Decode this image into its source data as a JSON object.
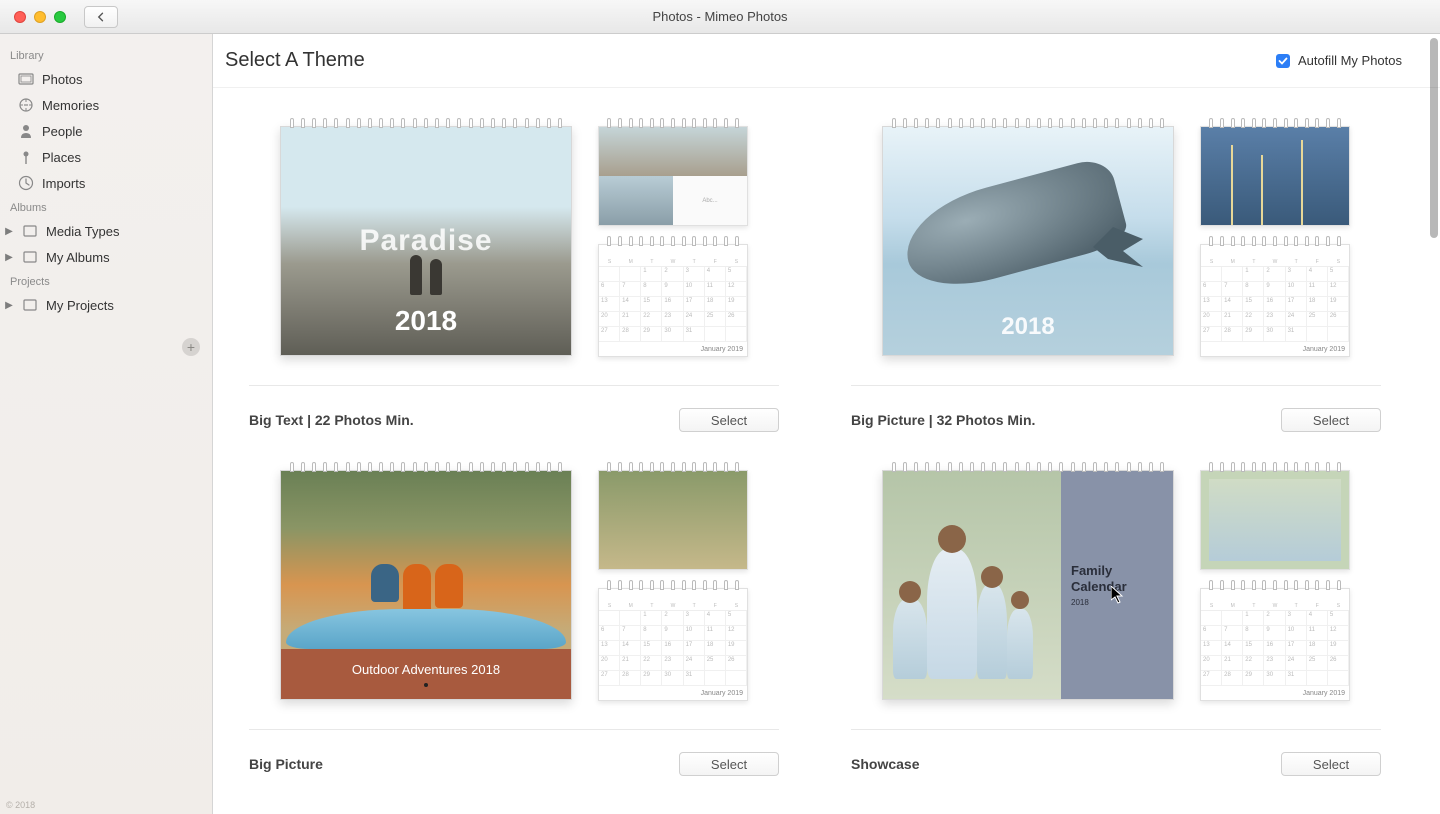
{
  "window": {
    "title": "Photos - Mimeo Photos"
  },
  "sidebar": {
    "sections": {
      "library": {
        "title": "Library",
        "items": [
          "Photos",
          "Memories",
          "People",
          "Places",
          "Imports"
        ]
      },
      "albums": {
        "title": "Albums",
        "items": [
          "Media Types",
          "My Albums"
        ]
      },
      "projects": {
        "title": "Projects",
        "items": [
          "My Projects"
        ]
      }
    },
    "copyright": "© 2018"
  },
  "header": {
    "title": "Select A Theme",
    "autofill_label": "Autofill My Photos",
    "autofill_checked": true
  },
  "themes": [
    {
      "id": "big-text",
      "title": "Big Text | 22 Photos Min.",
      "cover_title": "Paradise",
      "cover_year": "2018",
      "small_upper_text": "Abc...",
      "preview_month": "January 2019",
      "select_label": "Select"
    },
    {
      "id": "big-picture-32",
      "title": "Big Picture | 32 Photos Min.",
      "cover_year": "2018",
      "preview_month": "January 2019",
      "select_label": "Select"
    },
    {
      "id": "big-picture",
      "title": "Big Picture",
      "cover_caption": "Outdoor Adventures 2018",
      "preview_month": "January 2019",
      "select_label": "Select"
    },
    {
      "id": "showcase",
      "title": "Showcase",
      "side_label_1": "Family",
      "side_label_2": "Calendar",
      "side_year": "2018",
      "preview_month": "January 2019",
      "select_label": "Select"
    }
  ],
  "calendar_days": [
    "S",
    "M",
    "T",
    "W",
    "T",
    "F",
    "S"
  ]
}
